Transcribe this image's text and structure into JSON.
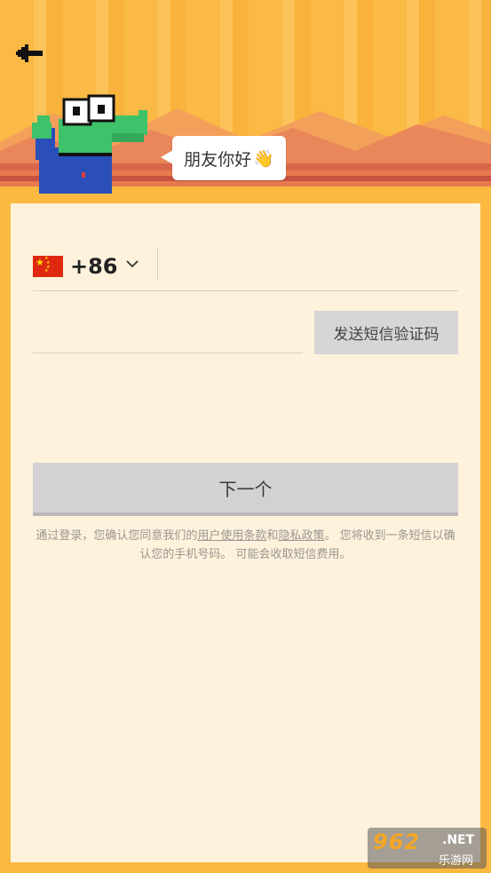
{
  "header": {
    "greeting": "朋友你好",
    "greeting_emoji": "👋",
    "back_icon": "arrow-left-icon"
  },
  "form": {
    "country_flag": "china-flag-icon",
    "country_code": "+86",
    "dropdown_icon": "chevron-down-icon",
    "phone_value": "",
    "code_value": "",
    "send_code_label": "发送短信验证码",
    "next_label": "下一个"
  },
  "terms": {
    "prefix": "通过登录，您确认您同意我们的",
    "terms_link": "用户使用条款",
    "and": "和",
    "privacy_link": "隐私政策",
    "suffix": "。 您将收到一条短信以确认您的手机号码。 可能会收取短信费用。"
  },
  "watermark": {
    "number": "962",
    "domain": ".NET",
    "site_name": "乐游网"
  },
  "colors": {
    "background": "#fbb940",
    "panel": "#fef2dc",
    "croc_green": "#3ec26a",
    "button_gray": "#d3d1d3"
  }
}
